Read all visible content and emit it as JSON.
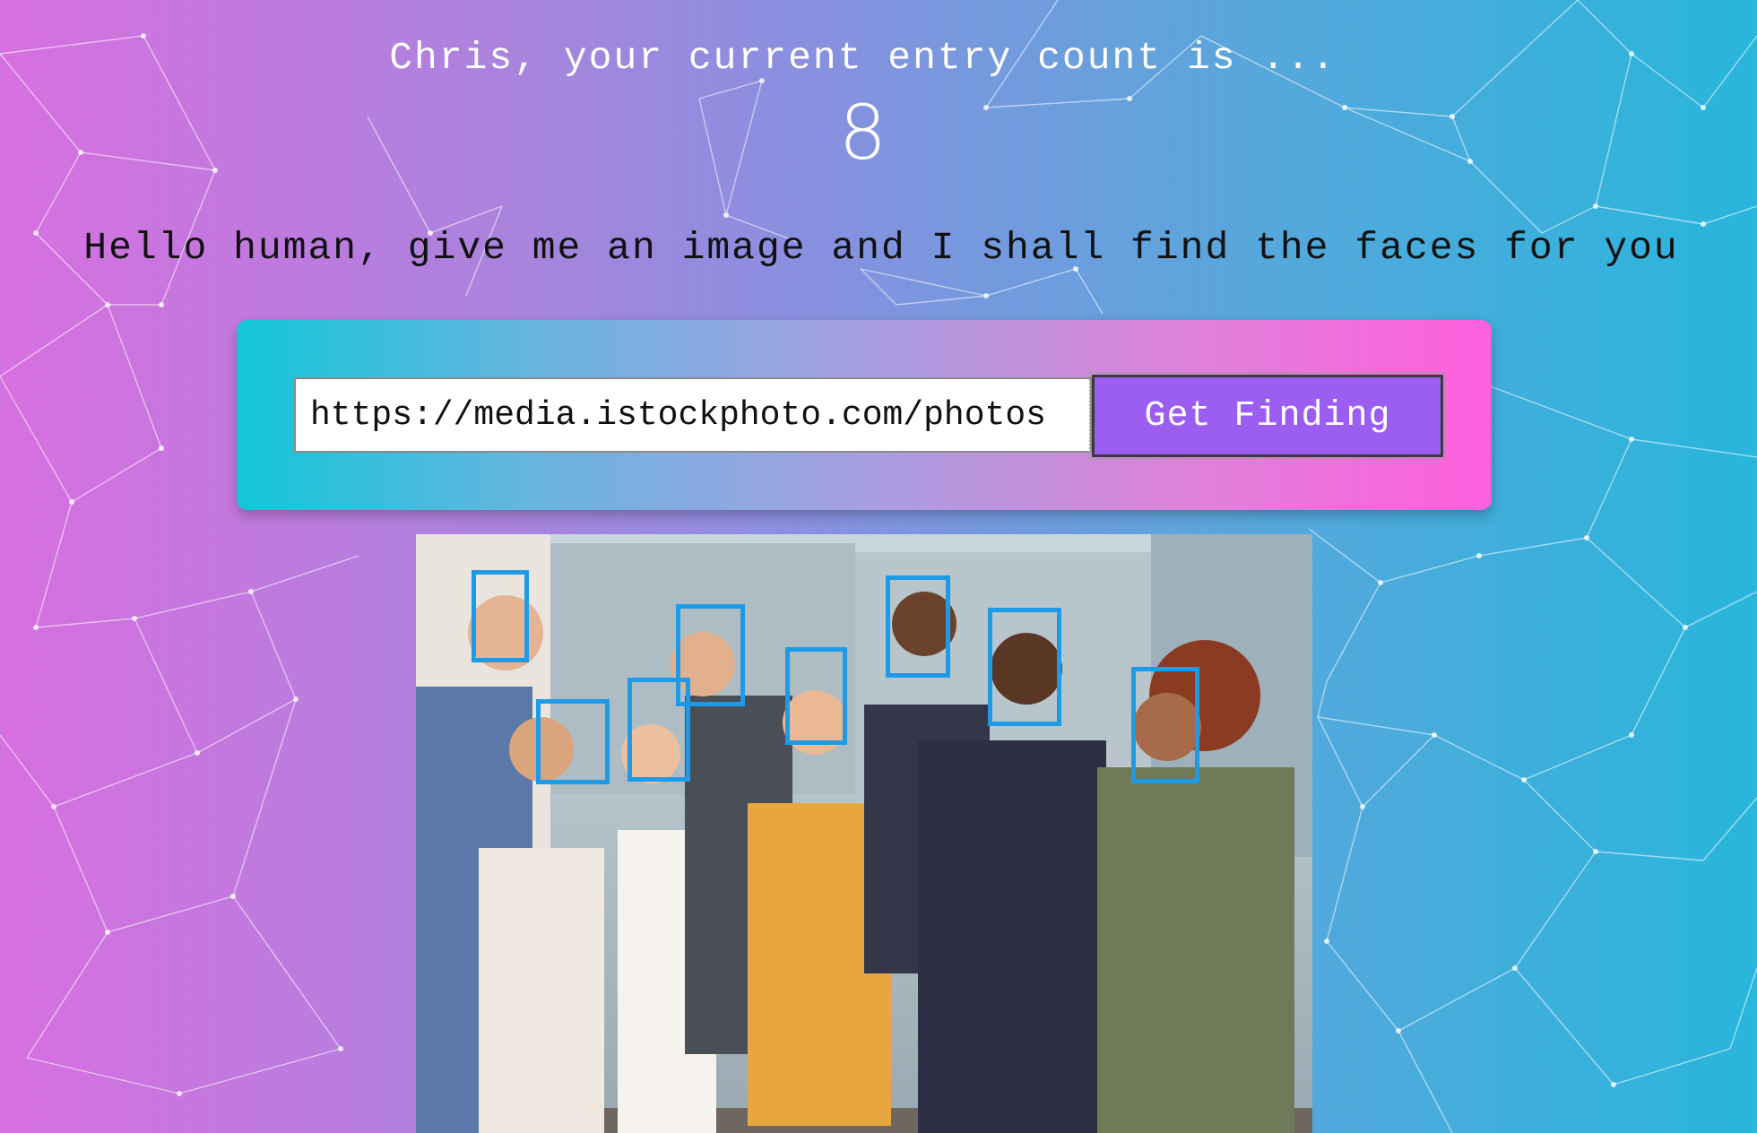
{
  "header": {
    "greeting": "Chris, your current entry count is ...",
    "entry_count": "8"
  },
  "instruction": "Hello human, give me an image and I shall find the faces for you",
  "form": {
    "url_value": "https://media.istockphoto.com/photos",
    "button_label": "Get Finding"
  },
  "result": {
    "faces_detected": 8,
    "box_color": "#1e9be8"
  },
  "colors": {
    "accent_button": "#9b5ef0",
    "gradient_left": "#d86fe0",
    "gradient_right": "#28b6dc"
  }
}
